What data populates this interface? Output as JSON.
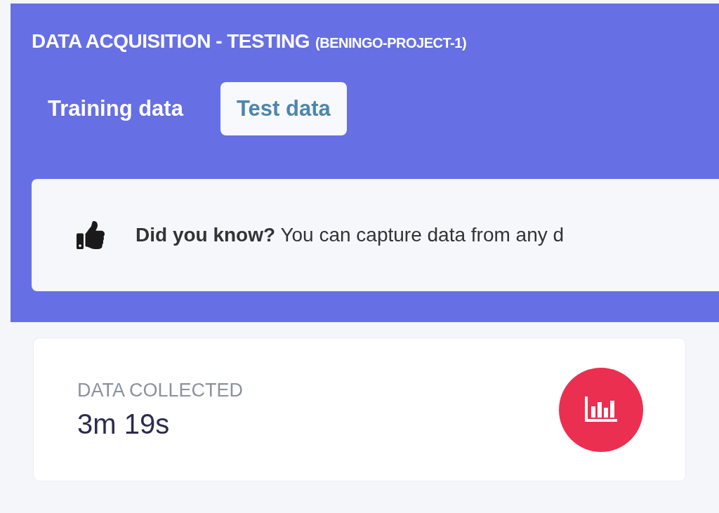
{
  "header": {
    "title": "DATA ACQUISITION - TESTING",
    "project": "(BENINGO-PROJECT-1)"
  },
  "tabs": [
    {
      "label": "Training data",
      "selected": false
    },
    {
      "label": "Test data",
      "selected": true
    }
  ],
  "tip": {
    "text": "**Did you know?** You can capture data from any d"
  },
  "stats": [
    {
      "label": "DATA COLLECTED",
      "value": "3m 19s"
    }
  ]
}
